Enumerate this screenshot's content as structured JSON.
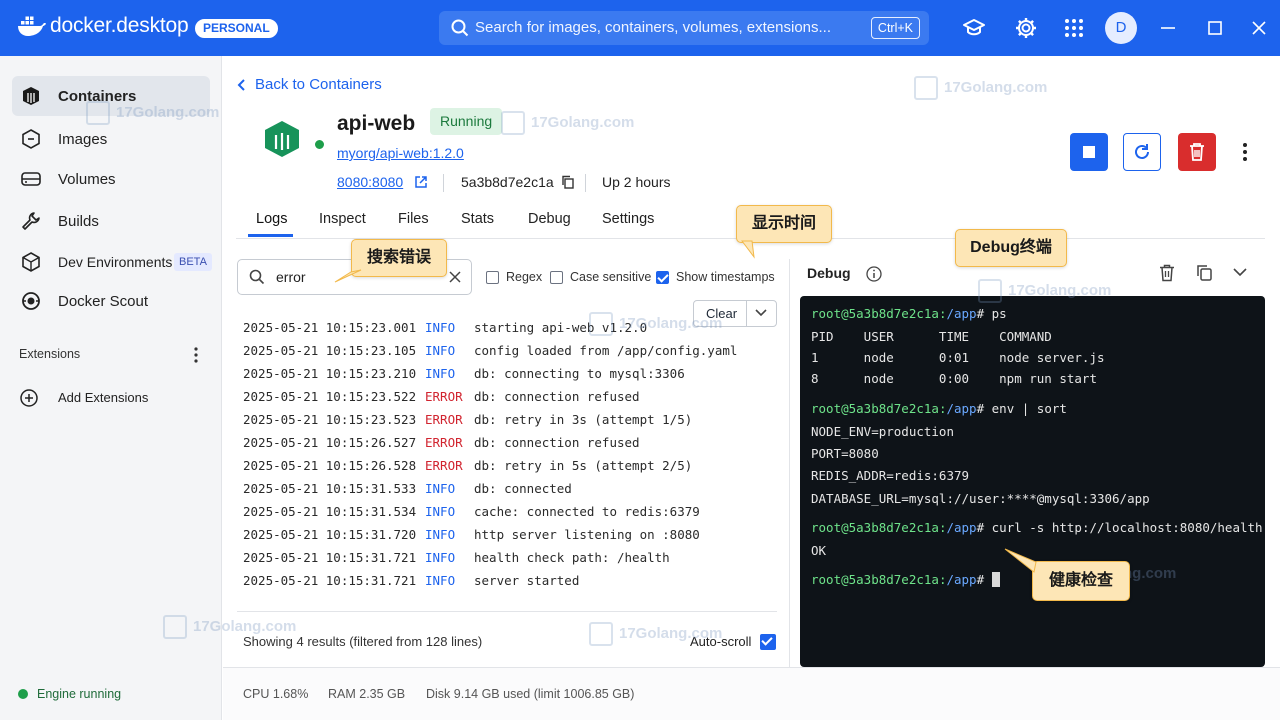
{
  "app": {
    "logo_text": "docker.desktop",
    "plan_badge": "PERSONAL",
    "search_placeholder": "Search for images, containers, volumes, extensions...",
    "search_shortcut": "Ctrl+K",
    "avatar_initial": "D",
    "brand_color": "#1d63ed"
  },
  "sidebar": {
    "items": [
      {
        "label": "Containers",
        "icon": "containers-icon",
        "active": true
      },
      {
        "label": "Images",
        "icon": "images-icon"
      },
      {
        "label": "Volumes",
        "icon": "volumes-icon"
      },
      {
        "label": "Builds",
        "icon": "builds-icon"
      },
      {
        "label": "Dev Environments",
        "icon": "dev-environments-icon",
        "badge": "BETA"
      },
      {
        "label": "Docker Scout",
        "icon": "docker-scout-icon"
      }
    ],
    "extensions_label": "Extensions",
    "add_extensions_label": "Add Extensions",
    "engine_status": "Engine running"
  },
  "container": {
    "back_label": "Back to Containers",
    "name": "api-web",
    "status": "Running",
    "image": "myorg/api-web:1.2.0",
    "port": "8080:8080",
    "id": "5a3b8d7e2c1a",
    "uptime": "Up 2 hours"
  },
  "tabs": [
    "Logs",
    "Inspect",
    "Files",
    "Stats",
    "Debug",
    "Settings"
  ],
  "active_tab": "Logs",
  "logs": {
    "search_value": "error",
    "options": [
      {
        "label": "Regex",
        "checked": false
      },
      {
        "label": "Case sensitive",
        "checked": false
      },
      {
        "label": "Show timestamps",
        "checked": true
      }
    ],
    "clear_label": "Clear",
    "lines": [
      {
        "ts": "2025-05-21 10:15:23.001",
        "level": "INFO",
        "msg": "starting api-web v1.2.0"
      },
      {
        "ts": "2025-05-21 10:15:23.105",
        "level": "INFO",
        "msg": "config loaded from /app/config.yaml"
      },
      {
        "ts": "2025-05-21 10:15:23.210",
        "level": "INFO",
        "msg": "db: connecting to mysql:3306"
      },
      {
        "ts": "2025-05-21 10:15:23.522",
        "level": "ERROR",
        "msg": "db: connection refused"
      },
      {
        "ts": "2025-05-21 10:15:23.523",
        "level": "ERROR",
        "msg": "db: retry in 3s (attempt 1/5)"
      },
      {
        "ts": "2025-05-21 10:15:26.527",
        "level": "ERROR",
        "msg": "db: connection refused"
      },
      {
        "ts": "2025-05-21 10:15:26.528",
        "level": "ERROR",
        "msg": "db: retry in 5s (attempt 2/5)"
      },
      {
        "ts": "2025-05-21 10:15:31.533",
        "level": "INFO",
        "msg": "db: connected"
      },
      {
        "ts": "2025-05-21 10:15:31.534",
        "level": "INFO",
        "msg": "cache: connected to redis:6379"
      },
      {
        "ts": "2025-05-21 10:15:31.720",
        "level": "INFO",
        "msg": "http server listening on :8080"
      },
      {
        "ts": "2025-05-21 10:15:31.721",
        "level": "INFO",
        "msg": "health check path: /health"
      },
      {
        "ts": "2025-05-21 10:15:31.721",
        "level": "INFO",
        "msg": "server started"
      }
    ],
    "results_text": "Showing 4 results (filtered from 128 lines)",
    "autoscroll_label": "Auto-scroll",
    "autoscroll_checked": true
  },
  "debug": {
    "title": "Debug",
    "prompt_user": "root@5a3b8d7e2c1a",
    "prompt_path": "/app",
    "terminal": [
      {
        "type": "cmd",
        "text": "ps"
      },
      {
        "type": "out",
        "text": "PID    USER      TIME    COMMAND"
      },
      {
        "type": "out",
        "text": "1      node      0:01    node server.js"
      },
      {
        "type": "out",
        "text": "8      node      0:00    npm run start"
      },
      {
        "type": "cmd",
        "text": "env | sort"
      },
      {
        "type": "out",
        "text": "NODE_ENV=production"
      },
      {
        "type": "out",
        "text": "PORT=8080"
      },
      {
        "type": "out",
        "text": "REDIS_ADDR=redis:6379"
      },
      {
        "type": "out",
        "text": "DATABASE_URL=mysql://user:****@mysql:3306/app"
      },
      {
        "type": "cmd",
        "text": "curl -s http://localhost:8080/health"
      },
      {
        "type": "out",
        "text": "OK"
      },
      {
        "type": "cmd",
        "text": ""
      }
    ]
  },
  "statusbar": {
    "cpu": "CPU 1.68%",
    "ram": "RAM 2.35 GB",
    "disk": "Disk 9.14 GB used (limit 1006.85 GB)"
  },
  "annotations": {
    "search_error": "搜索错误",
    "show_time": "显示时间",
    "debug_terminal": "Debug终端",
    "health_check": "健康检查"
  },
  "watermark": {
    "text": "17Golang.com"
  }
}
